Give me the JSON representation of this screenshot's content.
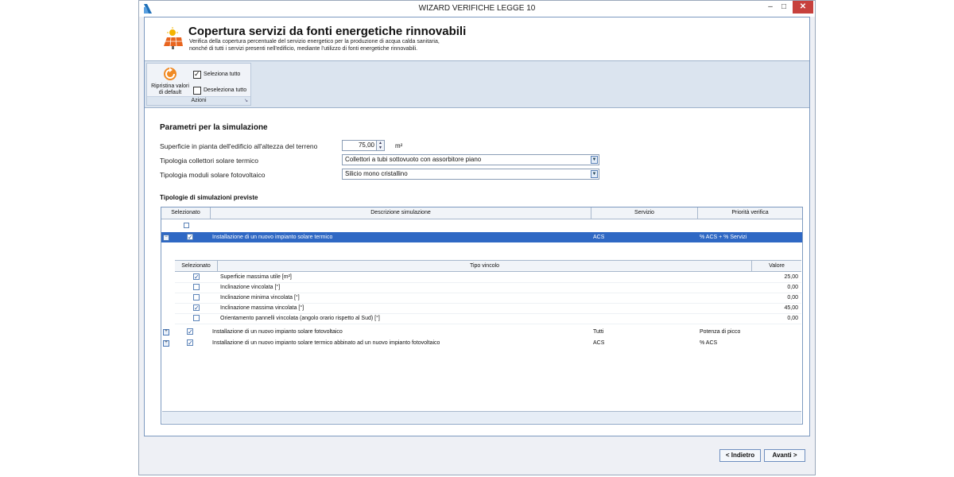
{
  "window": {
    "title": "WIZARD VERIFICHE LEGGE 10",
    "min_label": "–",
    "max_label": "□",
    "close_label": "✕"
  },
  "header": {
    "title": "Copertura servizi da fonti energetiche rinnovabili",
    "desc_line1": "Verifica della copertura percentuale del servizio energetico per la produzione di acqua calda sanitaria,",
    "desc_line2": "nonché di tutti i servizi presenti nell'edificio, mediante l'utilizzo di fonti energetiche rinnovabili."
  },
  "ribbon": {
    "reset_label_1": "Ripristina valori",
    "reset_label_2": "di default",
    "select_all": "Seleziona tutto",
    "deselect_all": "Deseleziona tutto",
    "group_label": "Azioni"
  },
  "params": {
    "section_title": "Parametri per la simulazione",
    "surface_label": "Superficie in pianta dell'edificio all'altezza del terreno",
    "surface_value": "75,00",
    "surface_unit": "m²",
    "collector_label": "Tipologia collettori solare termico",
    "collector_value": "Collettori a tubi sottovuoto con assorbitore piano",
    "pv_label": "Tipologia moduli solare fotovoltaico",
    "pv_value": "Silicio mono cristallino"
  },
  "simulations": {
    "section_title": "Tipologie di simulazioni previste",
    "columns": {
      "selected": "Selezionato",
      "description": "Descrizione simulazione",
      "service": "Servizio",
      "priority": "Priorità verifica"
    },
    "rows": [
      {
        "expander": "−",
        "checked": true,
        "description": "Installazione di un nuovo impianto solare termico",
        "service": "ACS",
        "priority": "% ACS + % Servizi"
      },
      {
        "expander": "+",
        "checked": true,
        "description": "Installazione di un nuovo impianto solare fotovoltaico",
        "service": "Tutti",
        "priority": "Potenza di picco"
      },
      {
        "expander": "+",
        "checked": true,
        "description": "Installazione di un nuovo impianto solare termico abbinato ad un nuovo impianto fotovoltaico",
        "service": "ACS",
        "priority": "% ACS"
      }
    ],
    "constraints": {
      "columns": {
        "selected": "Selezionato",
        "type": "Tipo vincolo",
        "value": "Valore"
      },
      "rows": [
        {
          "checked": true,
          "type": "Superficie massima utile [m²]",
          "value": "25,00"
        },
        {
          "checked": false,
          "type": "Inclinazione vincolata [°]",
          "value": "0,00"
        },
        {
          "checked": false,
          "type": "Inclinazione minima vincolata [°]",
          "value": "0,00"
        },
        {
          "checked": true,
          "type": "Inclinazione massima vincolata [°]",
          "value": "45,00"
        },
        {
          "checked": false,
          "type": "Orientamento pannelli vincolata (angolo orario rispetto al Sud) [°]",
          "value": "0,00"
        }
      ]
    }
  },
  "nav": {
    "back_label": "< Indietro",
    "next_label": "Avanti >"
  },
  "colors": {
    "selected_row": "#2f68c4",
    "close_button": "#c7413d",
    "panel_border": "#7d9ac0"
  }
}
